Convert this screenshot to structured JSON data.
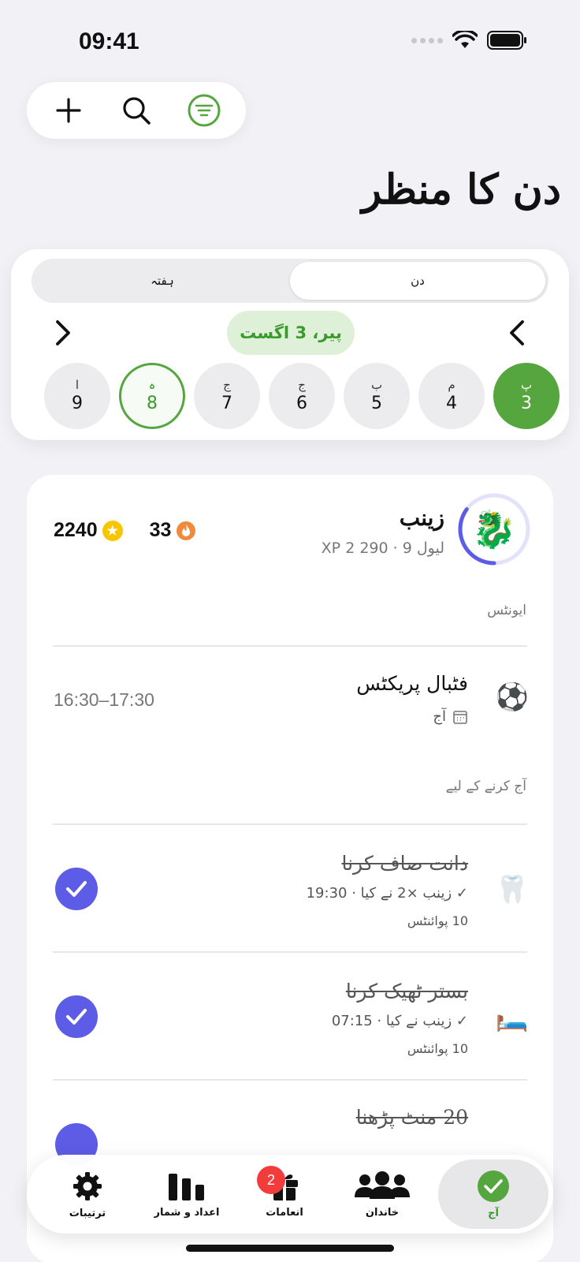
{
  "status_bar": {
    "time": "09:41",
    "icons": [
      "cellular-icon",
      "wifi-icon",
      "battery-icon"
    ]
  },
  "toolbar": {
    "icons": [
      "plus-icon",
      "search-icon",
      "filter-icon"
    ],
    "accent": "#55a63f"
  },
  "page": {
    "title": "دن کا منظر"
  },
  "date_card": {
    "segments": {
      "day": "دن",
      "week": "ہفتہ",
      "selected": "day"
    },
    "date_label": "پیر، 3 اگست",
    "days": [
      {
        "letter": "پ",
        "number": "3",
        "state": "selected"
      },
      {
        "letter": "م",
        "number": "4",
        "state": "normal"
      },
      {
        "letter": "ب",
        "number": "5",
        "state": "normal"
      },
      {
        "letter": "ج",
        "number": "6",
        "state": "normal"
      },
      {
        "letter": "ج",
        "number": "7",
        "state": "normal"
      },
      {
        "letter": "ہ",
        "number": "8",
        "state": "today"
      },
      {
        "letter": "ا",
        "number": "9",
        "state": "normal"
      }
    ]
  },
  "profile": {
    "name": "زینب",
    "level_text": "لیول 9 · 290 2 XP",
    "avatar_emoji": "🐉",
    "level_progress": 0.35,
    "stars": "2240",
    "streak": "33"
  },
  "sections": {
    "events_label": "ایونٹس",
    "todo_label": "آج کرنے کے لیے"
  },
  "event": {
    "emoji": "⚽",
    "title": "فٹبال پریکٹس",
    "subtitle": "آج",
    "time": "16:30–17:30"
  },
  "tasks": [
    {
      "emoji": "🦷",
      "title": "دانت صاف کرنا",
      "meta": "✓ زینب ×2 نے کیا · 19:30",
      "points": "10 پوائنٹس",
      "done": true
    },
    {
      "emoji": "🛏️",
      "title": "بستر ٹھیک کرنا",
      "meta": "✓ زینب نے کیا · 07:15",
      "points": "10 پوائنٹس",
      "done": true
    },
    {
      "emoji": "📖",
      "title": "20 منٹ پڑھنا",
      "meta": "",
      "points": "",
      "done": true
    }
  ],
  "tabbar": {
    "tabs": [
      {
        "label": "آج",
        "icon": "check-circle-icon",
        "active": true
      },
      {
        "label": "خاندان",
        "icon": "people-icon",
        "active": false
      },
      {
        "label": "انعامات",
        "icon": "gift-icon",
        "active": false,
        "badge": "2"
      },
      {
        "label": "اعداد و شمار",
        "icon": "bar-chart-icon",
        "active": false
      },
      {
        "label": "ترتیبات",
        "icon": "gear-icon",
        "active": false
      }
    ]
  },
  "colors": {
    "green": "#55a63f",
    "purple": "#5d5ce6",
    "badge_red": "#f23b3b",
    "star": "#f7c600",
    "flame": "#f08a3c"
  }
}
